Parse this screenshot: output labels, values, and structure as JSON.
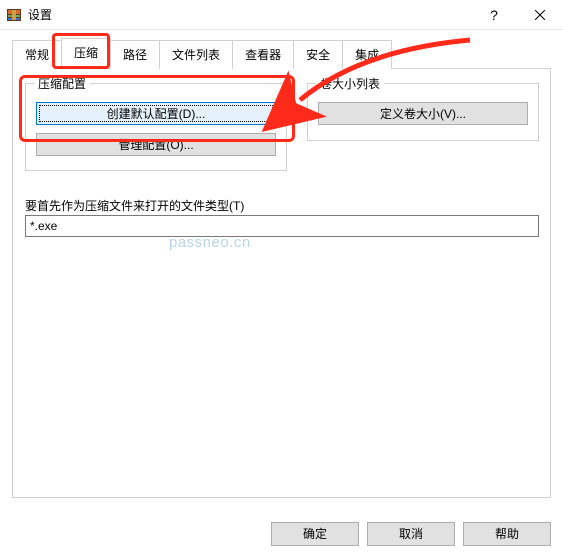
{
  "window": {
    "title": "设置"
  },
  "tabs": {
    "general": "常规",
    "compression": "压缩",
    "paths": "路径",
    "filelist": "文件列表",
    "viewer": "查看器",
    "security": "安全",
    "integration": "集成"
  },
  "group_compress": {
    "legend": "压缩配置",
    "create_default": "创建默认配置(D)...",
    "manage": "管理配置(O)..."
  },
  "group_volume": {
    "legend": "卷大小列表",
    "define": "定义卷大小(V)..."
  },
  "filetype_label": "要首先作为压缩文件来打开的文件类型(T)",
  "filetype_value": "*.exe",
  "footer": {
    "ok": "确定",
    "cancel": "取消",
    "help": "帮助"
  },
  "watermark": "passneo.cn"
}
